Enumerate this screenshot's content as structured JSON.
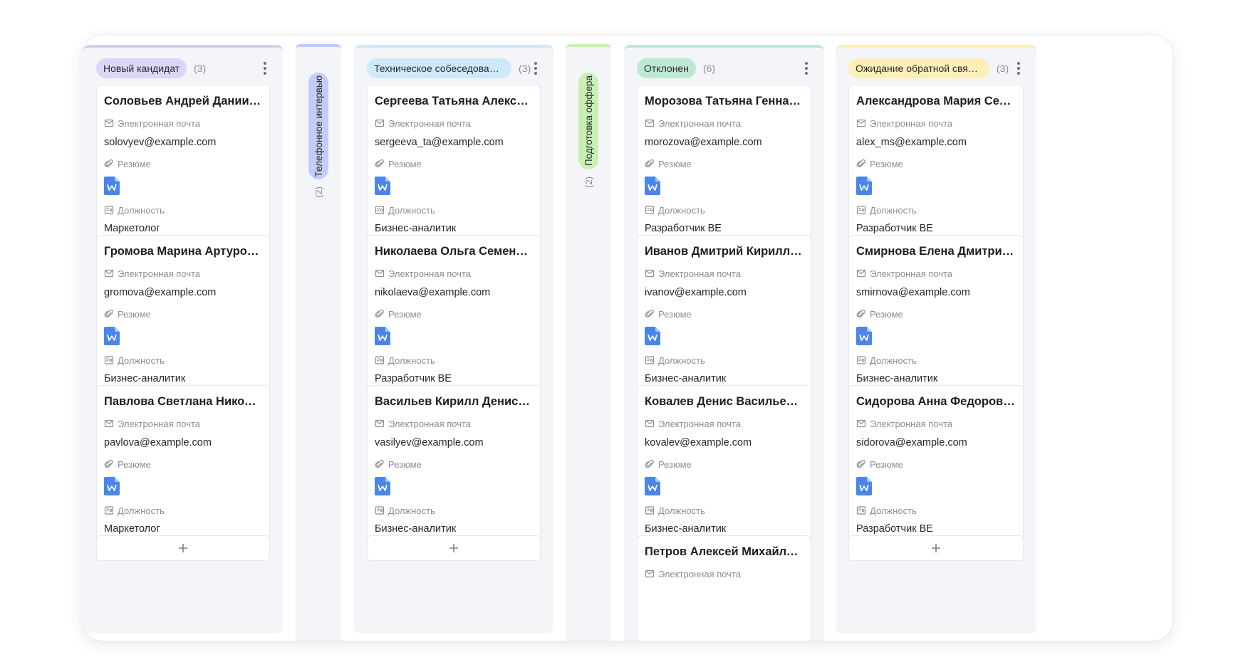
{
  "colors": {
    "new_candidate": "#ddd5f5",
    "new_candidate_border": "#d7cdf1",
    "phone": "#c2cdf7",
    "tech": "#cfe9fb",
    "offer": "#c8f0b4",
    "rejected": "#bfe8d4",
    "waiting": "#fcefb8",
    "doc_icon": "#4a86ea"
  },
  "labels": {
    "email": "Электронная почта",
    "resume": "Резюме",
    "position": "Должность"
  },
  "columns": [
    {
      "title": "Новый кандидат",
      "count": "(3)",
      "cards": [
        {
          "name": "Соловьев Андрей Даниилович",
          "email": "solovyev@example.com",
          "position": "Маркетолог"
        },
        {
          "name": "Громова Марина Артуровна",
          "email": "gromova@example.com",
          "position": "Бизнес-аналитик"
        },
        {
          "name": "Павлова Светлана Николаевна",
          "email": "pavlova@example.com",
          "position": "Маркетолог"
        }
      ]
    },
    {
      "title": "Техническое собеседование",
      "count": "(3)",
      "cards": [
        {
          "name": "Сергеева Татьяна Александ...",
          "email": "sergeeva_ta@example.com",
          "position": "Бизнес-аналитик"
        },
        {
          "name": "Николаева Ольга Семеновна",
          "email": "nikolaeva@example.com",
          "position": "Разработчик BE"
        },
        {
          "name": "Васильев Кирилл Денисович",
          "email": "vasilyev@example.com",
          "position": "Бизнес-аналитик"
        }
      ]
    },
    {
      "title": "Отклонен",
      "count": "(6)",
      "cards": [
        {
          "name": "Морозова Татьяна Геннадье...",
          "email": "morozova@example.com",
          "position": "Разработчик BE"
        },
        {
          "name": "Иванов Дмитрий Кириллович",
          "email": "ivanov@example.com",
          "position": "Бизнес-аналитик"
        },
        {
          "name": "Ковалев Денис Васильевич",
          "email": "kovalev@example.com",
          "position": "Бизнес-аналитик"
        },
        {
          "name": "Петров Алексей Михайлович"
        }
      ]
    },
    {
      "title": "Ожидание обратной связи о...",
      "count": "(3)",
      "cards": [
        {
          "name": "Александрова Мария Семен...",
          "email": "alex_ms@example.com",
          "position": "Разработчик BE"
        },
        {
          "name": "Смирнова Елена Дмитриевна",
          "email": "smirnova@example.com",
          "position": "Бизнес-аналитик"
        },
        {
          "name": "Сидорова Анна Федоровна",
          "email": "sidorova@example.com",
          "position": "Разработчик BE"
        }
      ]
    }
  ],
  "collapsed": [
    {
      "title": "Телефонное интервью",
      "count": "(2)"
    },
    {
      "title": "Подготовка оффера",
      "count": "(2)"
    }
  ]
}
